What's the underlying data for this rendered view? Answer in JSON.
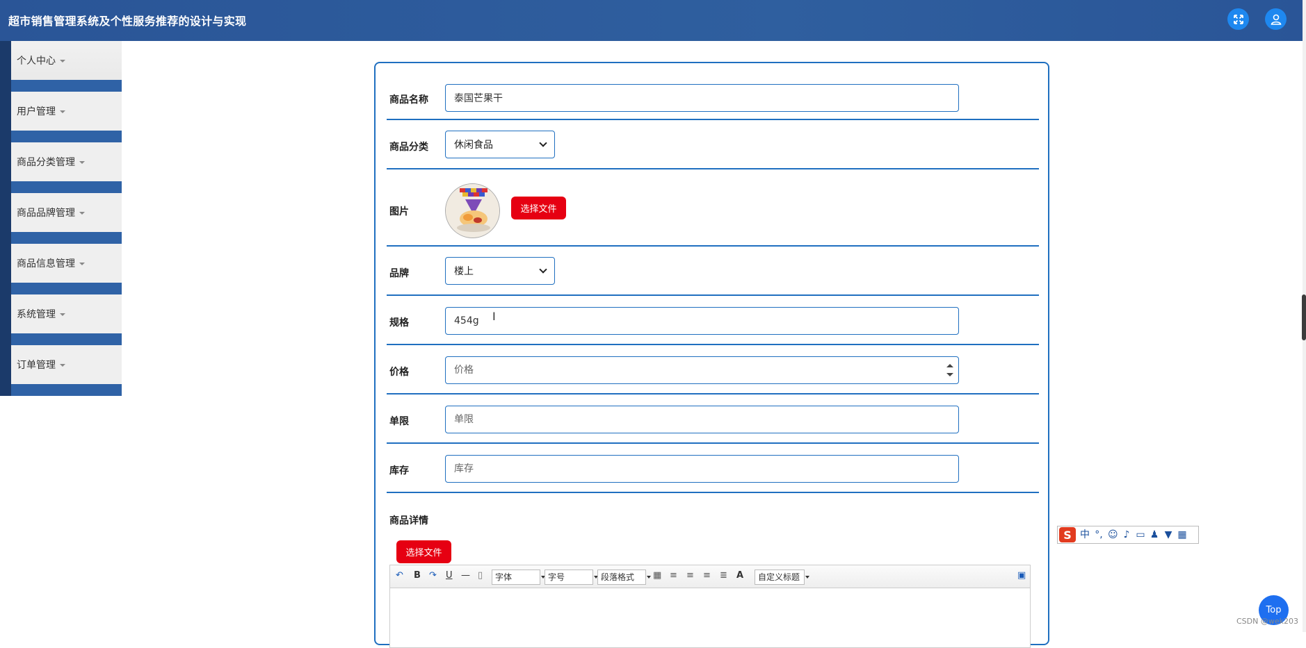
{
  "header": {
    "title": "超市销售管理系统及个性服务推荐的设计与实现"
  },
  "sidebar": {
    "items": [
      {
        "label": "个人中心"
      },
      {
        "label": "用户管理"
      },
      {
        "label": "商品分类管理"
      },
      {
        "label": "商品品牌管理"
      },
      {
        "label": "商品信息管理"
      },
      {
        "label": "系统管理"
      },
      {
        "label": "订单管理"
      }
    ]
  },
  "form": {
    "name": {
      "label": "商品名称",
      "value": "泰国芒果干"
    },
    "category": {
      "label": "商品分类",
      "value": "休闲食品"
    },
    "image": {
      "label": "图片",
      "button": "选择文件"
    },
    "brand": {
      "label": "品牌",
      "value": "楼上"
    },
    "spec": {
      "label": "规格",
      "value": "454g"
    },
    "price": {
      "label": "价格",
      "placeholder": "价格"
    },
    "limit": {
      "label": "单限",
      "placeholder": "单限"
    },
    "stock": {
      "label": "库存",
      "placeholder": "库存"
    },
    "detail": {
      "label": "商品详情",
      "button": "选择文件"
    }
  },
  "editor": {
    "font": "字体",
    "size": "字号",
    "paragraph": "段落格式",
    "custom_title": "自定义标题",
    "bold": "B",
    "underline": "U",
    "fontcolor": "A"
  },
  "ime": {
    "cn": "中",
    "punct": "°,"
  },
  "top_button": "Top",
  "watermark": "CSDN @wek203"
}
